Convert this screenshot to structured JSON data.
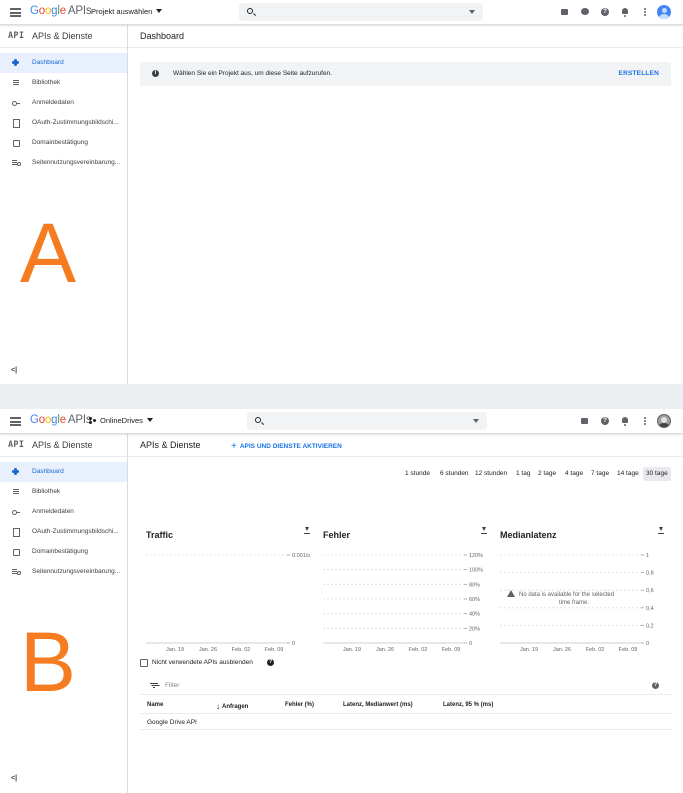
{
  "logo": {
    "google": "Google",
    "apis": "APIs"
  },
  "panel_a": {
    "project_selector": "Projekt auswählen",
    "section_title": "APIs & Dienste",
    "api_badge": "API",
    "page_title": "Dashboard",
    "notice": {
      "message": "Wählen Sie ein Projekt aus, um diese Seite aufzurufen.",
      "action": "ERSTELLEN"
    },
    "letter": "A"
  },
  "panel_b": {
    "project_selector": "OnlineDrives",
    "section_title": "APIs & Dienste",
    "api_badge": "API",
    "page_title": "APIs & Dienste",
    "enable_button": "APIS UND DIENSTE AKTIVIEREN",
    "time_ranges": [
      "1 stunde",
      "6 stunden",
      "12 stunden",
      "1 tag",
      "2 tage",
      "4 tage",
      "7 tage",
      "14 tage",
      "30 tage"
    ],
    "time_range_selected": "30 tage",
    "hide_unused_label": "Nicht verwendete APIs ausblenden",
    "filter_placeholder": "Filter",
    "table": {
      "headers": [
        "Name",
        "Anfragen",
        "Fehler (%)",
        "Latenz, Medianwert (ms)",
        "Latenz, 95 % (ms)"
      ],
      "rows": [
        [
          "Google Drive API"
        ]
      ]
    },
    "letter": "B"
  },
  "sidebar": {
    "items": [
      {
        "label": "Dashboard",
        "icon": "dashboard-icon",
        "active": true
      },
      {
        "label": "Bibliothek",
        "icon": "library-icon"
      },
      {
        "label": "Anmeldedaten",
        "icon": "key-icon"
      },
      {
        "label": "OAuth-Zustimmungsbildschi...",
        "icon": "oauth-icon"
      },
      {
        "label": "Domainbestätigung",
        "icon": "domain-icon"
      },
      {
        "label": "Seitennutzungsvereinbarung...",
        "icon": "site-terms-icon"
      }
    ],
    "collapse_glyph": "<|"
  },
  "colors": {
    "accent": "#1a73e8",
    "active_bg": "#e8f0fe",
    "letter": "#f57c20"
  },
  "chart_data": [
    {
      "type": "line",
      "title": "Traffic",
      "x_ticks": [
        "Jan. 19",
        "Jan. 26",
        "Feb. 02",
        "Feb. 09"
      ],
      "y_ticks": [
        "0.001/s",
        "0"
      ],
      "series": []
    },
    {
      "type": "line",
      "title": "Fehler",
      "x_ticks": [
        "Jan. 19",
        "Jan. 26",
        "Feb. 02",
        "Feb. 09"
      ],
      "y_ticks": [
        "120%",
        "100%",
        "80%",
        "60%",
        "40%",
        "20%",
        "0"
      ],
      "series": []
    },
    {
      "type": "line",
      "title": "Medianlatenz",
      "x_ticks": [
        "Jan. 19",
        "Jan. 26",
        "Feb. 02",
        "Feb. 09"
      ],
      "y_ticks": [
        "1",
        "0,8",
        "0,6",
        "0,4",
        "0,2",
        "0"
      ],
      "series": [],
      "annotation": "No data is available for the selected time frame."
    }
  ]
}
